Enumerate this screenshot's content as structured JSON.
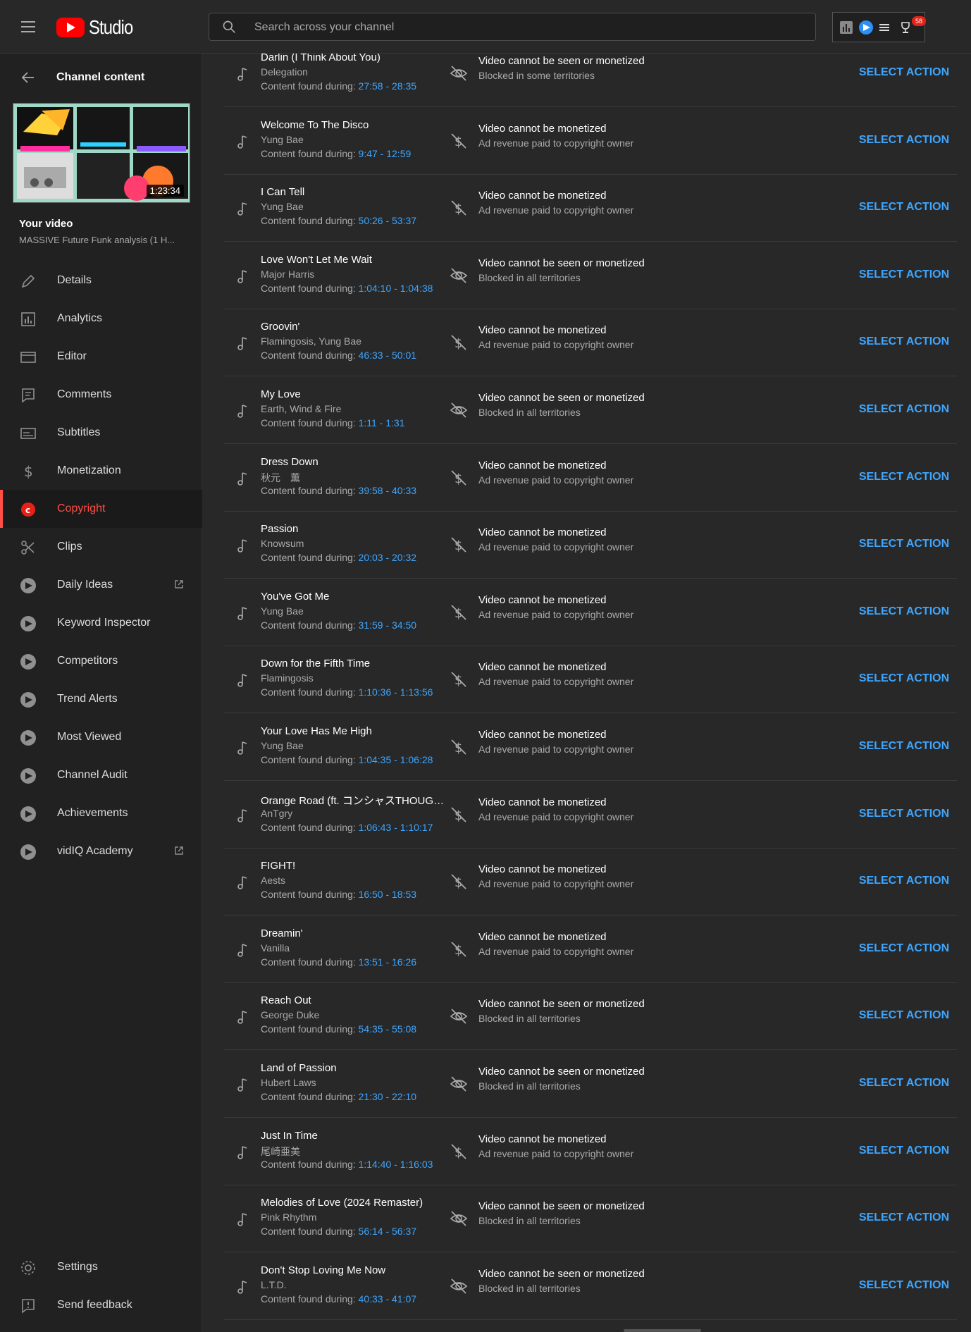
{
  "header": {
    "logo_text": "Studio",
    "search_placeholder": "Search across your channel",
    "notification_count": "58"
  },
  "sidebar": {
    "back_label": "Channel content",
    "thumbnail_duration": "1:23:34",
    "your_video_label": "Your video",
    "video_title": "MASSIVE Future Funk analysis (1 H...",
    "items": [
      {
        "label": "Details",
        "icon": "pencil-icon"
      },
      {
        "label": "Analytics",
        "icon": "analytics-icon"
      },
      {
        "label": "Editor",
        "icon": "editor-icon"
      },
      {
        "label": "Comments",
        "icon": "comments-icon"
      },
      {
        "label": "Subtitles",
        "icon": "subtitles-icon"
      },
      {
        "label": "Monetization",
        "icon": "dollar-icon"
      },
      {
        "label": "Copyright",
        "icon": "copyright-icon",
        "active": true
      },
      {
        "label": "Clips",
        "icon": "scissors-icon"
      },
      {
        "label": "Daily Ideas",
        "icon": "vidiq-icon",
        "external": true
      },
      {
        "label": "Keyword Inspector",
        "icon": "vidiq-icon"
      },
      {
        "label": "Competitors",
        "icon": "vidiq-icon"
      },
      {
        "label": "Trend Alerts",
        "icon": "vidiq-icon"
      },
      {
        "label": "Most Viewed",
        "icon": "vidiq-icon"
      },
      {
        "label": "Channel Audit",
        "icon": "vidiq-icon"
      },
      {
        "label": "Achievements",
        "icon": "vidiq-icon"
      },
      {
        "label": "vidIQ Academy",
        "icon": "vidiq-icon",
        "external": true
      }
    ],
    "bottom": [
      {
        "label": "Settings",
        "icon": "gear-icon"
      },
      {
        "label": "Send feedback",
        "icon": "feedback-icon"
      }
    ]
  },
  "claims": {
    "found_prefix": "Content found during: ",
    "action_label": "SELECT ACTION",
    "rows": [
      {
        "title": "Darlin (I Think About You)",
        "artist": "Delegation",
        "range": "27:58 - 28:35",
        "status": "Video cannot be seen or monetized",
        "sub": "Blocked in some territories",
        "icon": "eye-off-icon"
      },
      {
        "title": "Welcome To The Disco",
        "artist": "Yung Bae",
        "range": "9:47 - 12:59",
        "status": "Video cannot be monetized",
        "sub": "Ad revenue paid to copyright owner",
        "icon": "no-money-icon"
      },
      {
        "title": "I Can Tell",
        "artist": "Yung Bae",
        "range": "50:26 - 53:37",
        "status": "Video cannot be monetized",
        "sub": "Ad revenue paid to copyright owner",
        "icon": "no-money-icon"
      },
      {
        "title": "Love Won't Let Me Wait",
        "artist": "Major Harris",
        "range": "1:04:10 - 1:04:38",
        "status": "Video cannot be seen or monetized",
        "sub": "Blocked in all territories",
        "icon": "eye-off-icon"
      },
      {
        "title": "Groovin'",
        "artist": "Flamingosis, Yung Bae",
        "range": "46:33 - 50:01",
        "status": "Video cannot be monetized",
        "sub": "Ad revenue paid to copyright owner",
        "icon": "no-money-icon"
      },
      {
        "title": "My Love",
        "artist": "Earth, Wind & Fire",
        "range": "1:11 - 1:31",
        "status": "Video cannot be seen or monetized",
        "sub": "Blocked in all territories",
        "icon": "eye-off-icon"
      },
      {
        "title": "Dress Down",
        "artist": "秋元　薫",
        "range": "39:58 - 40:33",
        "status": "Video cannot be monetized",
        "sub": "Ad revenue paid to copyright owner",
        "icon": "no-money-icon"
      },
      {
        "title": "Passion",
        "artist": "Knowsum",
        "range": "20:03 - 20:32",
        "status": "Video cannot be monetized",
        "sub": "Ad revenue paid to copyright owner",
        "icon": "no-money-icon"
      },
      {
        "title": "You've Got Me",
        "artist": "Yung Bae",
        "range": "31:59 - 34:50",
        "status": "Video cannot be monetized",
        "sub": "Ad revenue paid to copyright owner",
        "icon": "no-money-icon"
      },
      {
        "title": "Down for the Fifth Time",
        "artist": "Flamingosis",
        "range": "1:10:36 - 1:13:56",
        "status": "Video cannot be monetized",
        "sub": "Ad revenue paid to copyright owner",
        "icon": "no-money-icon"
      },
      {
        "title": "Your Love Has Me High",
        "artist": "Yung Bae",
        "range": "1:04:35 - 1:06:28",
        "status": "Video cannot be monetized",
        "sub": "Ad revenue paid to copyright owner",
        "icon": "no-money-icon"
      },
      {
        "title": "Orange Road (ft. コンシャスTHOUGHTS)",
        "artist": "AnTgry",
        "range": "1:06:43 - 1:10:17",
        "status": "Video cannot be monetized",
        "sub": "Ad revenue paid to copyright owner",
        "icon": "no-money-icon"
      },
      {
        "title": "FIGHT!",
        "artist": "Aests",
        "range": "16:50 - 18:53",
        "status": "Video cannot be monetized",
        "sub": "Ad revenue paid to copyright owner",
        "icon": "no-money-icon"
      },
      {
        "title": "Dreamin'",
        "artist": "Vanilla",
        "range": "13:51 - 16:26",
        "status": "Video cannot be monetized",
        "sub": "Ad revenue paid to copyright owner",
        "icon": "no-money-icon"
      },
      {
        "title": "Reach Out",
        "artist": "George Duke",
        "range": "54:35 - 55:08",
        "status": "Video cannot be seen or monetized",
        "sub": "Blocked in all territories",
        "icon": "eye-off-icon"
      },
      {
        "title": "Land of Passion",
        "artist": "Hubert Laws",
        "range": "21:30 - 22:10",
        "status": "Video cannot be seen or monetized",
        "sub": "Blocked in all territories",
        "icon": "eye-off-icon"
      },
      {
        "title": "Just In Time",
        "artist": "尾崎亜美",
        "range": "1:14:40 - 1:16:03",
        "status": "Video cannot be monetized",
        "sub": "Ad revenue paid to copyright owner",
        "icon": "no-money-icon"
      },
      {
        "title": "Melodies of Love (2024 Remaster)",
        "artist": "Pink Rhythm",
        "range": "56:14 - 56:37",
        "status": "Video cannot be seen or monetized",
        "sub": "Blocked in all territories",
        "icon": "eye-off-icon"
      },
      {
        "title": "Don't Stop Loving Me Now",
        "artist": "L.T.D.",
        "range": "40:33 - 41:07",
        "status": "Video cannot be seen or monetized",
        "sub": "Blocked in all territories",
        "icon": "eye-off-icon"
      }
    ]
  }
}
